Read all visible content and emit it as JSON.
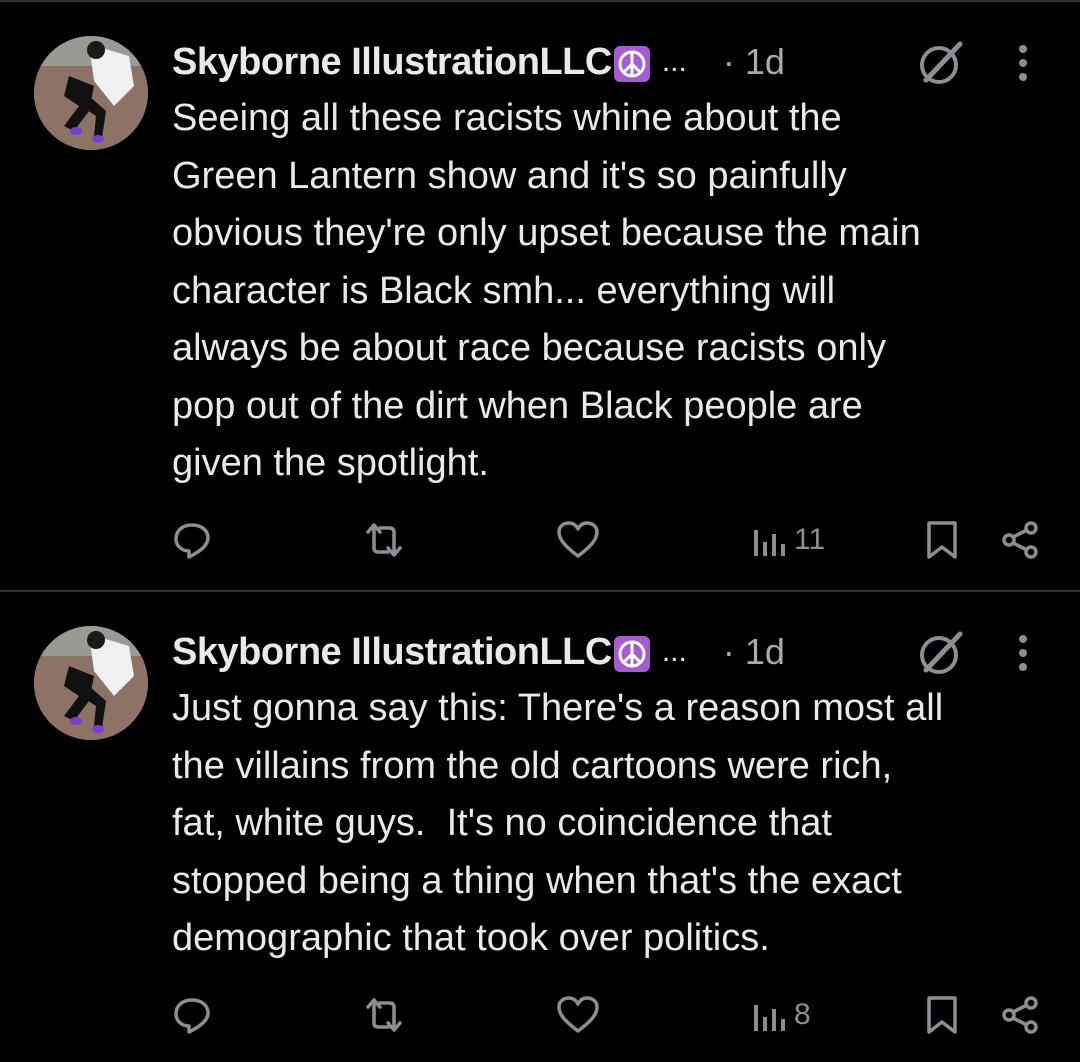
{
  "colors": {
    "background": "#000000",
    "text": "#e7e9ea",
    "muted": "#8b8f94",
    "divider": "#2f3336",
    "peace_emoji_bg": "#a55ccf"
  },
  "posts": [
    {
      "author": "Skyborne IllustrationLLC",
      "emoji_icon": "peace-symbol-icon",
      "ellipsis": "...",
      "time": "· 1d",
      "text": "Seeing all these racists whine about the\nGreen Lantern show and it's so painfully\nobvious they're only upset because the main\ncharacter is Black smh... everything will\nalways be about race because racists only\npop out of the dirt when Black people are\ngiven the spotlight.",
      "views": "11"
    },
    {
      "author": "Skyborne IllustrationLLC",
      "emoji_icon": "peace-symbol-icon",
      "ellipsis": "...",
      "time": "· 1d",
      "text": "Just gonna say this: There's a reason most all\nthe villains from the old cartoons were rich,\nfat, white guys.  It's no coincidence that\nstopped being a thing when that's the exact\ndemographic that took over politics.",
      "views": "8"
    }
  ]
}
